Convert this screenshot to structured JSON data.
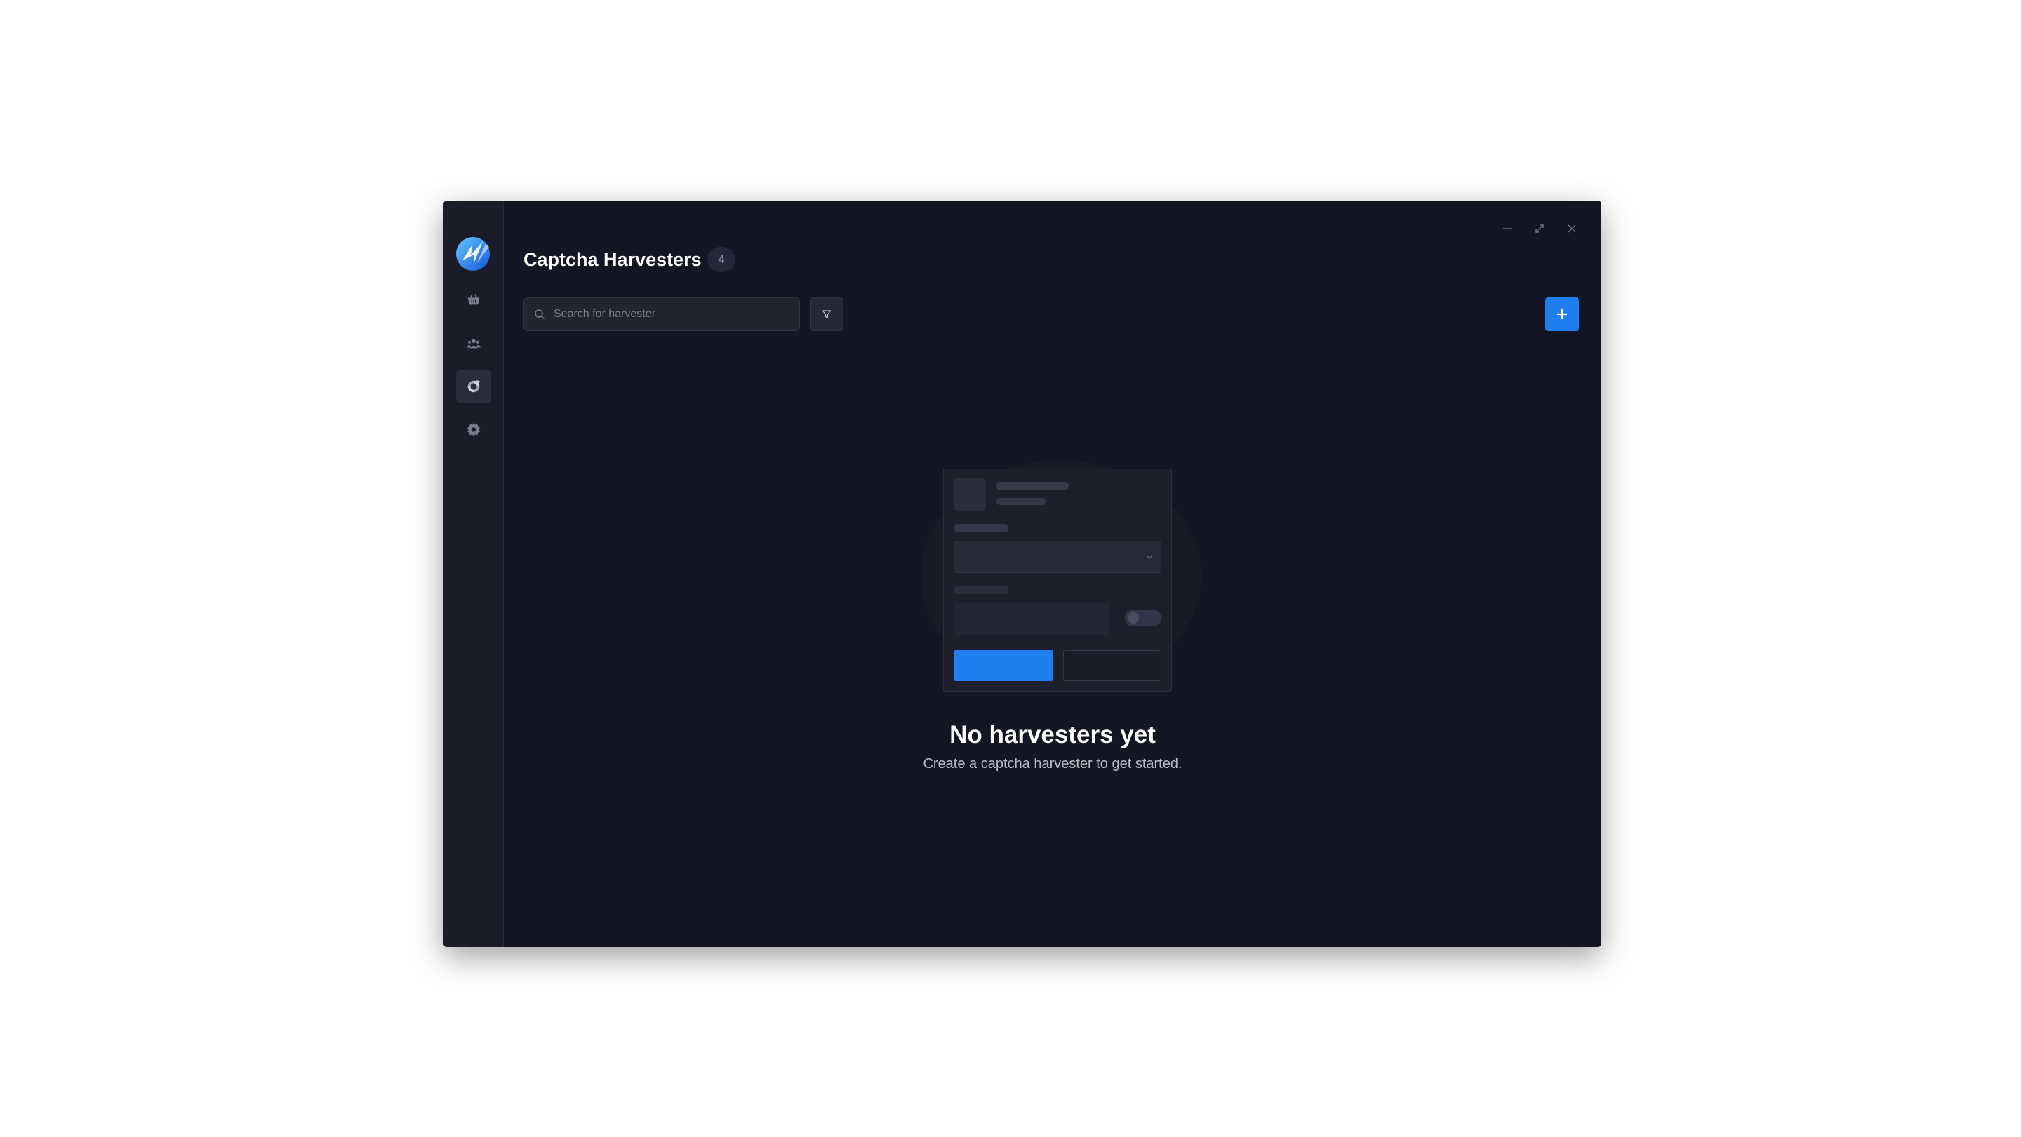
{
  "window": {
    "controls": [
      "minimize-icon",
      "maximize-icon",
      "close-icon"
    ]
  },
  "sidebar": {
    "logo": "brand-logo",
    "items": [
      {
        "icon": "basket-icon",
        "name": "sidebar-item-tasks",
        "active": false
      },
      {
        "icon": "users-icon",
        "name": "sidebar-item-profiles",
        "active": false
      },
      {
        "icon": "captcha-icon",
        "name": "sidebar-item-captcha-harvesters",
        "active": true
      },
      {
        "icon": "gear-icon",
        "name": "sidebar-item-settings",
        "active": false
      }
    ]
  },
  "header": {
    "title": "Captcha Harvesters",
    "count": "4"
  },
  "toolbar": {
    "search_placeholder": "Search for harvester",
    "search_value": "",
    "filter_icon": "filter-icon",
    "add_icon": "plus-icon"
  },
  "empty_state": {
    "title": "No harvesters yet",
    "subtitle": "Create a captcha harvester to get started."
  },
  "colors": {
    "accent": "#1f7ef0",
    "background": "#141626",
    "sidebar": "#1a1c2a"
  }
}
